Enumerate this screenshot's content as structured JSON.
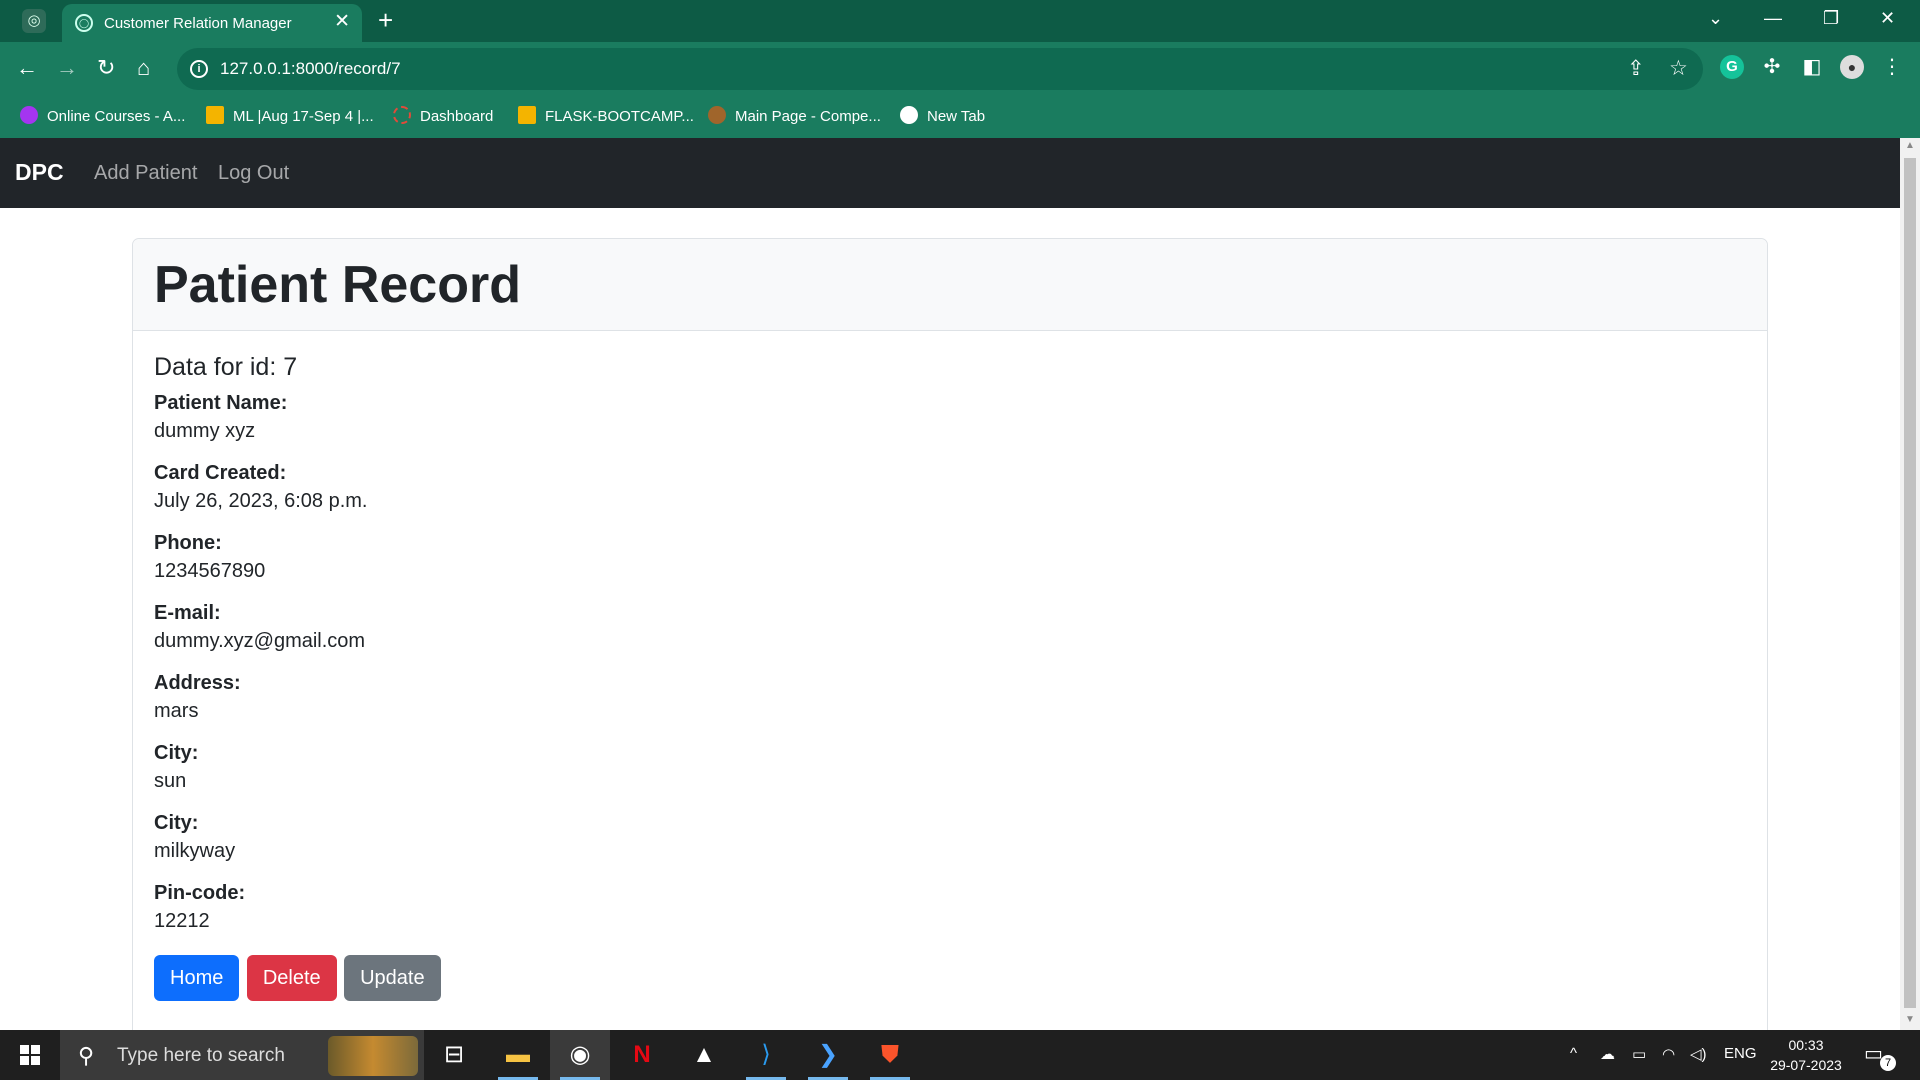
{
  "browser": {
    "tab_title": "Customer Relation Manager",
    "url": "127.0.0.1:8000/record/7",
    "bookmarks": [
      {
        "label": "Online Courses - A...",
        "color": "#a435f0"
      },
      {
        "label": "ML |Aug 17-Sep 4 |...",
        "color": "#f4b400"
      },
      {
        "label": "Dashboard",
        "color": "#e04b3a"
      },
      {
        "label": "FLASK-BOOTCAMP...",
        "color": "#f4b400"
      },
      {
        "label": "Main Page - Compe...",
        "color": "#a0652b"
      },
      {
        "label": "New Tab",
        "color": "#ffffff"
      }
    ]
  },
  "navbar": {
    "brand": "DPC",
    "links": [
      "Add Patient",
      "Log Out"
    ]
  },
  "record": {
    "title": "Patient Record",
    "subtitle": "Data for id: 7",
    "fields": [
      {
        "label": "Patient Name:",
        "value": "dummy xyz"
      },
      {
        "label": "Card Created:",
        "value": "July 26, 2023, 6:08 p.m."
      },
      {
        "label": "Phone:",
        "value": "1234567890"
      },
      {
        "label": "E-mail:",
        "value": "dummy.xyz@gmail.com"
      },
      {
        "label": "Address:",
        "value": "mars"
      },
      {
        "label": "City:",
        "value": "sun"
      },
      {
        "label": "City:",
        "value": "milkyway"
      },
      {
        "label": "Pin-code:",
        "value": "12212"
      }
    ],
    "buttons": {
      "home": "Home",
      "delete": "Delete",
      "update": "Update"
    }
  },
  "taskbar": {
    "search_placeholder": "Type here to search",
    "language": "ENG",
    "time": "00:33",
    "date": "29-07-2023",
    "notifications": "7"
  },
  "colors": {
    "home_button": "#0d6efd",
    "delete_button": "#dc3545",
    "update_button": "#6c757d",
    "navbar": "#212529",
    "browser_frame": "#1a7c5f"
  }
}
